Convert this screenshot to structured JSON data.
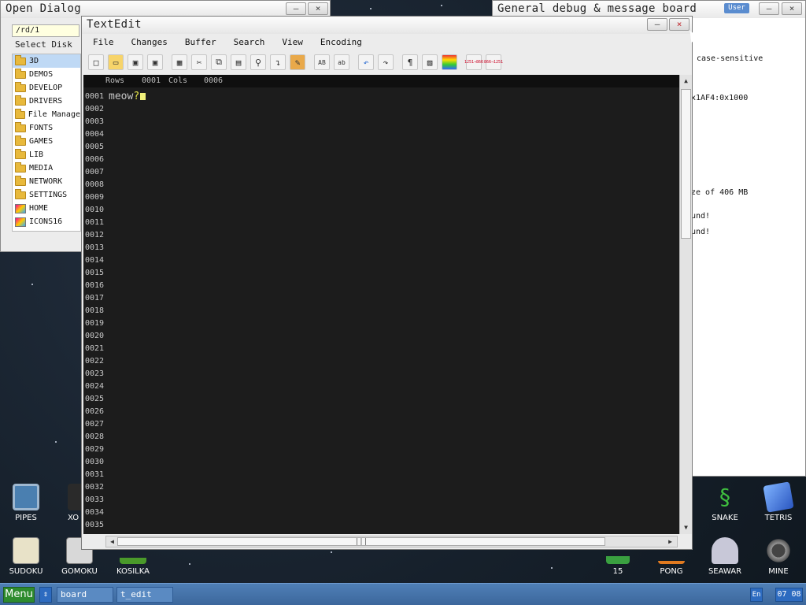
{
  "open_dialog": {
    "title": "Open Dialog",
    "minimize": "–",
    "close": "×",
    "path": "/rd/1",
    "select_disk": "Select Disk",
    "items": [
      {
        "label": "3D",
        "icon": "folder-icon"
      },
      {
        "label": "DEMOS",
        "icon": "folder-icon"
      },
      {
        "label": "DEVELOP",
        "icon": "folder-icon"
      },
      {
        "label": "DRIVERS",
        "icon": "folder-icon"
      },
      {
        "label": "File Manage",
        "icon": "folder-icon"
      },
      {
        "label": "FONTS",
        "icon": "folder-icon"
      },
      {
        "label": "GAMES",
        "icon": "folder-icon"
      },
      {
        "label": "LIB",
        "icon": "folder-icon"
      },
      {
        "label": "MEDIA",
        "icon": "folder-icon"
      },
      {
        "label": "NETWORK",
        "icon": "folder-icon"
      },
      {
        "label": "SETTINGS",
        "icon": "folder-icon"
      },
      {
        "label": "HOME",
        "icon": "image-icon"
      },
      {
        "label": "ICONS16",
        "icon": "image-icon"
      }
    ]
  },
  "debug_board": {
    "title": "General debug & message board",
    "user": "User",
    "minimize": "–",
    "close": "×",
    "lines": [
      "case-sensitive",
      "x1AF4:0x1000",
      "ze of 406 MB",
      "und!",
      "und!"
    ]
  },
  "textedit": {
    "title": "TextEdit",
    "minimize": "–",
    "close": "×",
    "menu": [
      "File",
      "Changes",
      "Buffer",
      "Search",
      "View",
      "Encoding"
    ],
    "toolbar": [
      {
        "name": "new-file-icon",
        "glyph": "□"
      },
      {
        "name": "open-folder-icon",
        "glyph": "▭"
      },
      {
        "name": "save-icon",
        "glyph": "▣"
      },
      {
        "name": "save-as-icon",
        "glyph": "▣"
      },
      {
        "name": "select-all-icon",
        "glyph": "▦"
      },
      {
        "name": "cut-icon",
        "glyph": "✂"
      },
      {
        "name": "copy-icon",
        "glyph": "⧉"
      },
      {
        "name": "paste-icon",
        "glyph": "▤"
      },
      {
        "name": "find-icon",
        "glyph": "⚲"
      },
      {
        "name": "goto-line-icon",
        "glyph": "↴"
      },
      {
        "name": "key-words-icon",
        "glyph": "✎"
      },
      {
        "name": "uppercase-icon",
        "glyph": "AB"
      },
      {
        "name": "lowercase-icon",
        "glyph": "ab"
      },
      {
        "name": "undo-icon",
        "glyph": "↶"
      },
      {
        "name": "redo-icon",
        "glyph": "↷"
      },
      {
        "name": "pilcrow-icon",
        "glyph": "¶"
      },
      {
        "name": "color-scheme-icon",
        "glyph": "▨"
      },
      {
        "name": "syntax-colors-icon",
        "glyph": "≡"
      },
      {
        "name": "convert-1251-866-icon",
        "glyph": "1251→866"
      },
      {
        "name": "convert-866-1251-icon",
        "glyph": "866→1251"
      }
    ],
    "status": {
      "rows_label": "Rows",
      "rows_value": "0001",
      "cols_label": "Cols",
      "cols_value": "0006"
    },
    "line_numbers": [
      "0001",
      "0002",
      "0003",
      "0004",
      "0005",
      "0006",
      "0007",
      "0008",
      "0009",
      "0010",
      "0011",
      "0012",
      "0013",
      "0014",
      "0015",
      "0016",
      "0017",
      "0018",
      "0019",
      "0020",
      "0021",
      "0022",
      "0023",
      "0024",
      "0025",
      "0026",
      "0027",
      "0028",
      "0029",
      "0030",
      "0031",
      "0032",
      "0033",
      "0034",
      "0035"
    ],
    "text": {
      "line1_word": "meow",
      "line1_mark": "?"
    },
    "hscroll_grip": "|||"
  },
  "desktop_icons": [
    {
      "label": "PIPES",
      "icon": "pipes-icon",
      "color": "#4a7fb0"
    },
    {
      "label": "XO",
      "icon": "xo-icon",
      "color": "#2a2a2a"
    },
    {
      "label": "SNAKE",
      "icon": "snake-icon",
      "color": "#1e6b2a"
    },
    {
      "label": "TETRIS",
      "icon": "tetris-icon",
      "color": "#3b6fd0"
    },
    {
      "label": "SUDOKU",
      "icon": "sudoku-icon",
      "color": "#e8e2c8"
    },
    {
      "label": "GOMOKU",
      "icon": "gomoku-icon",
      "color": "#d8d8d8"
    },
    {
      "label": "KOSILKA",
      "icon": "kosilka-icon",
      "color": "#4a9a2a"
    },
    {
      "label": "15",
      "icon": "fifteen-icon",
      "color": "#3aa040"
    },
    {
      "label": "PONG",
      "icon": "pong-icon",
      "color": "#e07a20"
    },
    {
      "label": "SEAWAR",
      "icon": "seawar-icon",
      "color": "#c8c8d8"
    },
    {
      "label": "MINE",
      "icon": "mine-icon",
      "color": "#888888"
    }
  ],
  "taskbar": {
    "menu": "Menu",
    "arrow": "⇕",
    "tasks": [
      "board",
      "t_edit"
    ],
    "lang": "En",
    "clock": "07 08"
  }
}
